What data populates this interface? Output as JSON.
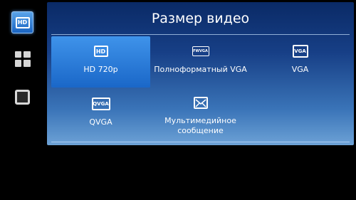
{
  "sidebar": {
    "hd_button_label": "HD"
  },
  "dialog": {
    "title": "Размер видео",
    "options": [
      {
        "label": "HD 720p",
        "icon": "hd-icon",
        "icon_text": "HD",
        "selected": true
      },
      {
        "label": "Полноформатный VGA",
        "icon": "fwvga-icon",
        "icon_text": "FWVGA",
        "selected": false
      },
      {
        "label": "VGA",
        "icon": "vga-icon",
        "icon_text": "VGA",
        "selected": false
      },
      {
        "label": "QVGA",
        "icon": "qvga-icon",
        "icon_text": "QVGA",
        "selected": false
      },
      {
        "label": "Мультимедийное сообщение",
        "icon": "mms-envelope-icon",
        "icon_text": "",
        "selected": false
      }
    ]
  },
  "colors": {
    "selected_bg": "#2a7fdc",
    "dialog_top": "#0a2a66",
    "dialog_bottom": "#6da2d6"
  }
}
